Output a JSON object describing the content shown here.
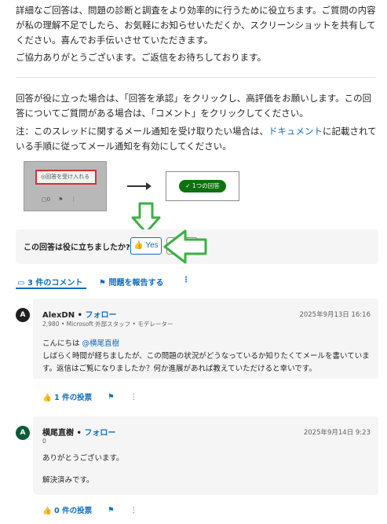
{
  "intro": {
    "para1": "詳細なご回答は、問題の診断と調査をより効率的に行うために役立ちます。ご質問の内容が私の理解不足でしたら、お気軽にお知らせいただくか、スクリーンショットを共有してください。喜んでお手伝いさせていただきます。",
    "para2": "ご協力ありがとうございます。ご返信をお待ちしております。"
  },
  "info": {
    "para1": "回答が役に立った場合は、「回答を承認」をクリックし、高評価をお願いします。この回答についてご質問がある場合は、「コメント」をクリックしてください。",
    "note_prefix": "注：このスレッドに関するメール通知を受け取りたい場合は、",
    "note_link": "ドキュメント",
    "note_suffix": "に記載されている手順に従ってメール通知を有効にしてください。"
  },
  "illustration": {
    "accept_label": "◎回答を受け入れる",
    "answers_label": "✓ 1つの回答",
    "mini_comment_count": "0"
  },
  "helpful": {
    "question": "この回答は役に立ちましたか?",
    "yes_label": "Yes"
  },
  "actions": {
    "comments_label": "3 件のコメント",
    "report_label": "問題を報告する",
    "more": "⋮"
  },
  "comments": [
    {
      "avatar": "A",
      "avatar_color": "#1f1f1f",
      "author": "AlexDN",
      "follow": "フォロー",
      "separator": "•",
      "meta": "2,980 • Microsoft 外部スタッフ • モデレーター",
      "date": "2025年9月13日 16:16",
      "greeting": "こんにちは ",
      "mention": "@横尾直樹",
      "body": "しばらく時間が経ちましたが、この問題の状況がどうなっているか知りたくてメールを書いています。返信はご覧になりましたか？何か進展があれば教えていただけると幸いです。",
      "votes": "1 件の投票"
    },
    {
      "avatar": "A",
      "avatar_color": "#0b5a3a",
      "author": "横尾直樹",
      "follow": "フォロー",
      "separator": "•",
      "meta": "0",
      "date": "2025年9月14日 9:23",
      "line1": "ありがとうございます。",
      "line2": "解決済みです。",
      "votes": "0 件の投票"
    }
  ],
  "icons": {
    "thumb": "👍",
    "flag": "⚑",
    "more": "⋮",
    "comment": "💬"
  }
}
